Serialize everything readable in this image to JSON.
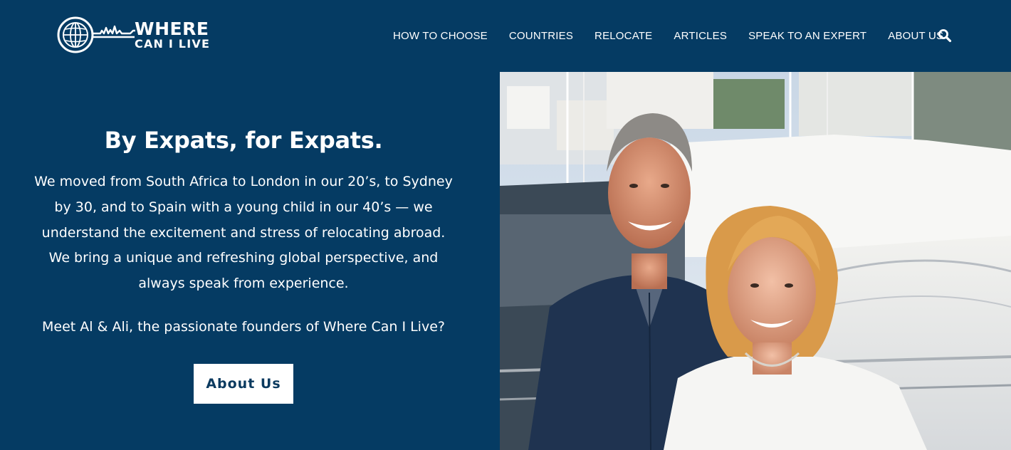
{
  "header": {
    "logo": {
      "line1": "WHERE",
      "line2": "CAN I LIVE",
      "icon": "globe-key-icon"
    },
    "nav": [
      {
        "label": "HOW TO CHOOSE"
      },
      {
        "label": "COUNTRIES"
      },
      {
        "label": "RELOCATE"
      },
      {
        "label": "ARTICLES"
      },
      {
        "label": "SPEAK TO AN EXPERT"
      },
      {
        "label": "ABOUT US"
      }
    ],
    "search_icon": "search-icon"
  },
  "hero": {
    "title": "By Expats, for Expats.",
    "body": "We moved from South Africa to London in our 20’s, to Sydney by 30, and to Spain with a young child in our 40’s — we understand the excitement and stress of relocating abroad. We bring a unique and refreshing global perspective, and always speak from experience.",
    "meet": "Meet Al & Ali, the passionate founders of Where Can I Live?",
    "button_label": "About Us"
  },
  "colors": {
    "background": "#053b63",
    "text": "#ffffff",
    "button_bg": "#ffffff",
    "button_text": "#0b3a5f"
  }
}
